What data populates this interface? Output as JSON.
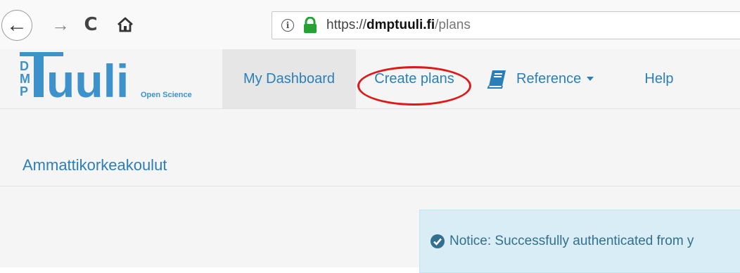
{
  "browser": {
    "url_prefix": "https://",
    "url_domain": "dmptuuli.fi",
    "url_path": "/plans",
    "icons": [
      "back-icon",
      "forward-icon",
      "reload-icon",
      "home-icon",
      "info-icon",
      "lock-icon"
    ]
  },
  "site": {
    "logo": {
      "letters": "DMP",
      "name": "Tuuli",
      "tagline": "Open Science"
    },
    "nav": {
      "dashboard": "My Dashboard",
      "create_plans": "Create plans",
      "reference": "Reference",
      "help": "Help"
    },
    "org_title": "Ammattikorkeakoulut",
    "notice": "Notice: Successfully authenticated from y"
  },
  "colors": {
    "link": "#2b7fb8",
    "logo_blue": "#3d92cc",
    "highlight_red": "#e01818",
    "notice_bg": "#d9edf7",
    "notice_text": "#31708f",
    "lock_green": "#22a333"
  }
}
